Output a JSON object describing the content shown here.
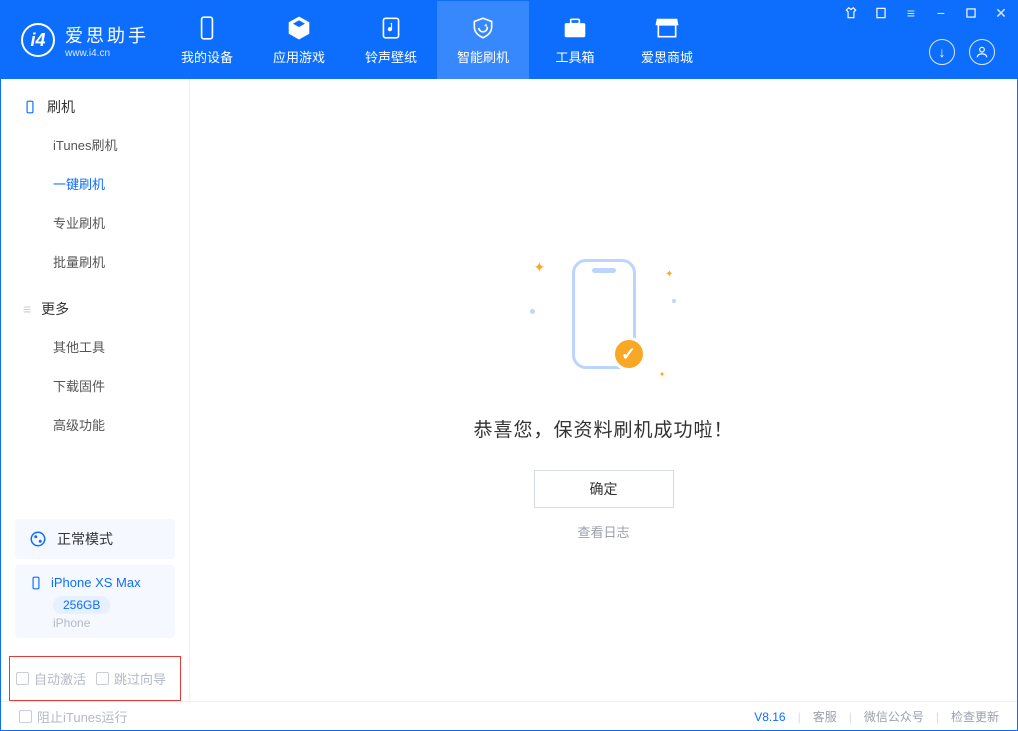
{
  "app": {
    "name_cn": "爱思助手",
    "name_en": "www.i4.cn"
  },
  "nav": {
    "items": [
      {
        "label": "我的设备"
      },
      {
        "label": "应用游戏"
      },
      {
        "label": "铃声壁纸"
      },
      {
        "label": "智能刷机"
      },
      {
        "label": "工具箱"
      },
      {
        "label": "爱思商城"
      }
    ]
  },
  "sidebar": {
    "sections": [
      {
        "title": "刷机",
        "items": [
          {
            "label": "iTunes刷机"
          },
          {
            "label": "一键刷机"
          },
          {
            "label": "专业刷机"
          },
          {
            "label": "批量刷机"
          }
        ]
      },
      {
        "title": "更多",
        "items": [
          {
            "label": "其他工具"
          },
          {
            "label": "下载固件"
          },
          {
            "label": "高级功能"
          }
        ]
      }
    ],
    "mode_label": "正常模式",
    "device": {
      "name": "iPhone XS Max",
      "capacity": "256GB",
      "type": "iPhone"
    },
    "checkboxes": {
      "auto_activate": "自动激活",
      "skip_guide": "跳过向导"
    }
  },
  "main": {
    "success_text": "恭喜您，保资料刷机成功啦！",
    "confirm_label": "确定",
    "log_link": "查看日志"
  },
  "footer": {
    "block_itunes": "阻止iTunes运行",
    "version": "V8.16",
    "links": {
      "support": "客服",
      "wechat": "微信公众号",
      "update": "检查更新"
    }
  }
}
